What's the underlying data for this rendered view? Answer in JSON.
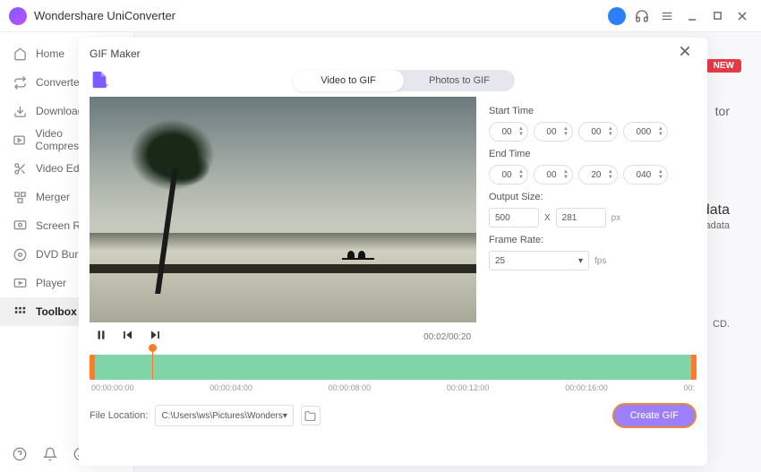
{
  "app": {
    "title": "Wondershare UniConverter"
  },
  "sidebar": {
    "items": [
      {
        "label": "Home"
      },
      {
        "label": "Converter"
      },
      {
        "label": "Downloader"
      },
      {
        "label": "Video Compressor"
      },
      {
        "label": "Video Editor"
      },
      {
        "label": "Merger"
      },
      {
        "label": "Screen Recorder"
      },
      {
        "label": "DVD Burner"
      },
      {
        "label": "Player"
      },
      {
        "label": "Toolbox"
      }
    ]
  },
  "bg": {
    "new": "NEW",
    "tor": "tor",
    "data": "data",
    "etadata": "etadata",
    "cd": "CD."
  },
  "modal": {
    "title": "GIF Maker",
    "tabs": {
      "video": "Video to GIF",
      "photos": "Photos to GIF"
    },
    "time": "00:02/00:20",
    "start": {
      "label": "Start Time",
      "h": "00",
      "m": "00",
      "s": "00",
      "ms": "000"
    },
    "end": {
      "label": "End Time",
      "h": "00",
      "m": "00",
      "s": "20",
      "ms": "040"
    },
    "size": {
      "label": "Output Size:",
      "w": "500",
      "h": "281",
      "unit": "px"
    },
    "rate": {
      "label": "Frame Rate:",
      "value": "25",
      "unit": "fps"
    },
    "ruler": [
      "00:00:00:00",
      "00:00:04:00",
      "00:00:08:00",
      "00:00:12:00",
      "00:00:16:00",
      "00:"
    ],
    "file": {
      "label": "File Location:",
      "path": "C:\\Users\\ws\\Pictures\\Wonders"
    },
    "create": "Create GIF"
  }
}
